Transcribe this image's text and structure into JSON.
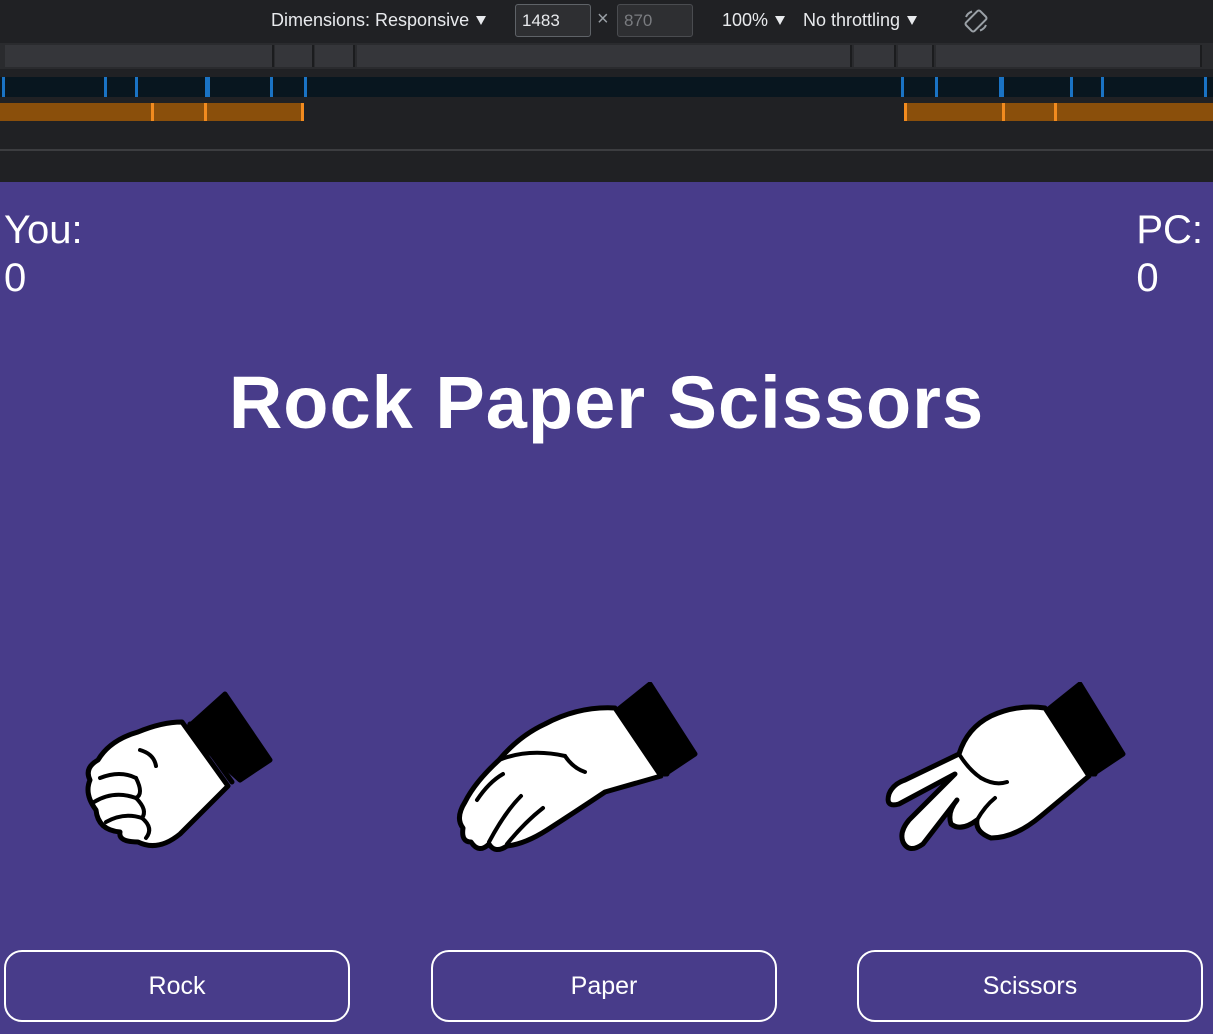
{
  "devtools": {
    "dimensions_label": "Dimensions: Responsive",
    "width_value": "1483",
    "height_value": "870",
    "times_symbol": "×",
    "zoom": "100%",
    "throttling": "No throttling",
    "rotate_icon": "rotate-icon",
    "colors": {
      "toolbar_bg": "#202124",
      "breakpoint": "#1a73c4",
      "media_query": "#f28b1f"
    }
  },
  "page": {
    "background": "#483c8a",
    "you_label": "You:",
    "you_score": "0",
    "pc_label": "PC:",
    "pc_score": "0",
    "title": "Rock Paper Scissors",
    "hands": [
      "rock-hand-icon",
      "paper-hand-icon",
      "scissors-hand-icon"
    ],
    "buttons": [
      "Rock",
      "Paper",
      "Scissors"
    ]
  }
}
